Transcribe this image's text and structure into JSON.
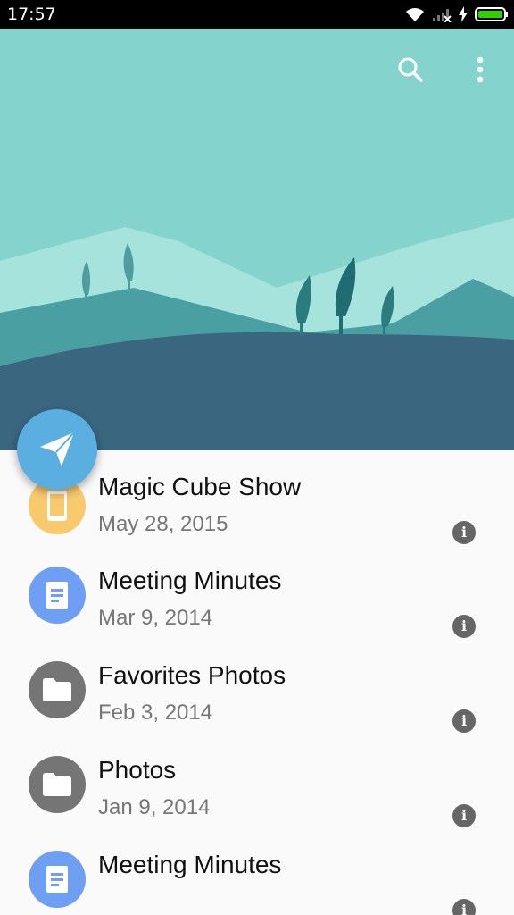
{
  "status": {
    "time": "17:57"
  },
  "toolbar": {
    "search_icon": "search-icon",
    "more_icon": "more-vert-icon"
  },
  "fab": {
    "icon": "send-icon",
    "color": "#5aaee0"
  },
  "files": [
    {
      "title": "Magic Cube Show",
      "date": "May 28, 2015",
      "icon": "tablet-icon",
      "color": "#f9c96e"
    },
    {
      "title": "Meeting Minutes",
      "date": "Mar 9, 2014",
      "icon": "document-icon",
      "color": "#6f9ff2"
    },
    {
      "title": "Favorites Photos",
      "date": "Feb 3, 2014",
      "icon": "folder-icon",
      "color": "#757575"
    },
    {
      "title": "Photos",
      "date": "Jan 9, 2014",
      "icon": "folder-icon",
      "color": "#757575"
    },
    {
      "title": "Meeting Minutes",
      "date": "",
      "icon": "document-icon",
      "color": "#6f9ff2"
    }
  ]
}
